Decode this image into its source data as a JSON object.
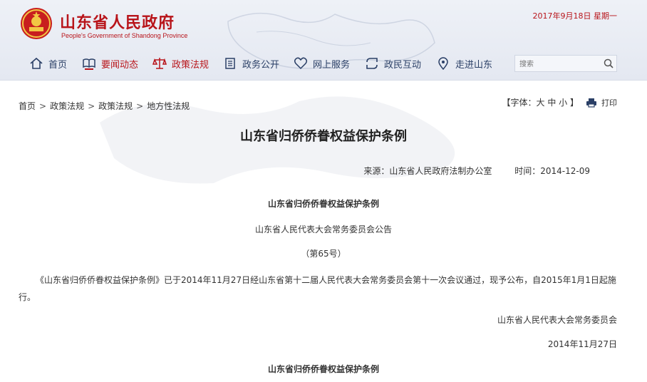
{
  "header": {
    "title": "山东省人民政府",
    "subtitle": "People's Government of Shandong Province",
    "date": "2017年9月18日  星期一",
    "colors": {
      "brand_red": "#b8141a",
      "nav_text": "#2a3f66",
      "header_bg": "#e8ecf4"
    }
  },
  "nav": {
    "items": [
      {
        "label": "首页",
        "icon": "home-icon"
      },
      {
        "label": "要闻动态",
        "icon": "book-icon"
      },
      {
        "label": "政策法规",
        "icon": "scales-icon"
      },
      {
        "label": "政务公开",
        "icon": "building-icon"
      },
      {
        "label": "网上服务",
        "icon": "heart-icon"
      },
      {
        "label": "政民互动",
        "icon": "interact-icon"
      },
      {
        "label": "走进山东",
        "icon": "map-pin-icon"
      }
    ]
  },
  "search": {
    "placeholder": "搜索"
  },
  "breadcrumb": [
    "首页",
    "政策法规",
    "政策法规",
    "地方性法规"
  ],
  "tools": {
    "font_size": "【字体：大 中 小 】",
    "print": "打印"
  },
  "article": {
    "title": "山东省归侨侨眷权益保护条例",
    "source": "来源：山东省人民政府法制办公室",
    "time": "时间：2014-12-09",
    "heading": "山东省归侨侨眷权益保护条例",
    "announcement": "山东省人民代表大会常务委员会公告",
    "number": "（第65号）",
    "paragraph": "《山东省归侨侨眷权益保护条例》已于2014年11月27日经山东省第十二届人民代表大会常务委员会第十一次会议通过，现予公布，自2015年1月1日起施行。",
    "signature": "山东省人民代表大会常务委员会",
    "sign_date": "2014年11月27日",
    "heading2": "山东省归侨侨眷权益保护条例"
  }
}
